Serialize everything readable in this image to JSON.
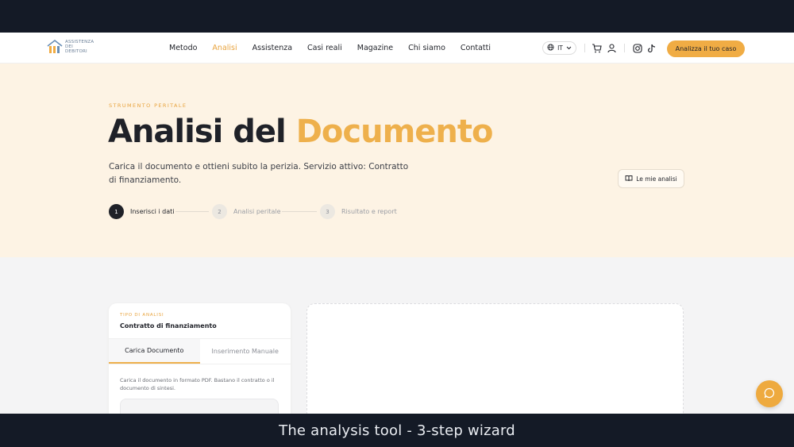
{
  "logo": {
    "lines": [
      "ASSISTENZA",
      "DEI",
      "DEBITORI"
    ]
  },
  "nav": {
    "items": [
      {
        "label": "Metodo",
        "active": false
      },
      {
        "label": "Analisi",
        "active": true
      },
      {
        "label": "Assistenza",
        "active": false
      },
      {
        "label": "Casi reali",
        "active": false
      },
      {
        "label": "Magazine",
        "active": false
      },
      {
        "label": "Chi siamo",
        "active": false
      },
      {
        "label": "Contatti",
        "active": false
      }
    ],
    "language": "IT",
    "icons": [
      "globe-icon",
      "chevron-down-icon",
      "cart-icon",
      "user-icon",
      "instagram-icon",
      "tiktok-icon"
    ],
    "cta_label": "Analizza il tuo caso"
  },
  "hero": {
    "eyebrow": "STRUMENTO PERITALE",
    "title_main": "Analisi del",
    "title_accent": "Documento",
    "description": "Carica il documento e ottieni subito la perizia. Servizio attivo: Contratto di finanziamento.",
    "my_analyses_label": "Le mie analisi",
    "steps": [
      {
        "number": "1",
        "label": "Inserisci i dati",
        "current": true
      },
      {
        "number": "2",
        "label": "Analisi peritale",
        "current": false
      },
      {
        "number": "3",
        "label": "Risultato e report",
        "current": false
      }
    ]
  },
  "form_card": {
    "type_label": "TIPO DI ANALISI",
    "type_value": "Contratto di finanziamento",
    "tabs": [
      {
        "label": "Carica Documento",
        "active": true
      },
      {
        "label": "Inserimento Manuale",
        "active": false
      }
    ],
    "hint": "Carica il documento in formato PDF. Bastano il contratto o il documento di sintesi."
  },
  "caption": "The analysis tool - 3-step wizard",
  "colors": {
    "accent": "#EEB04C",
    "dark": "#1F2128",
    "hero_bg": "#FDF3E4",
    "content_bg": "#F4F4F5"
  }
}
